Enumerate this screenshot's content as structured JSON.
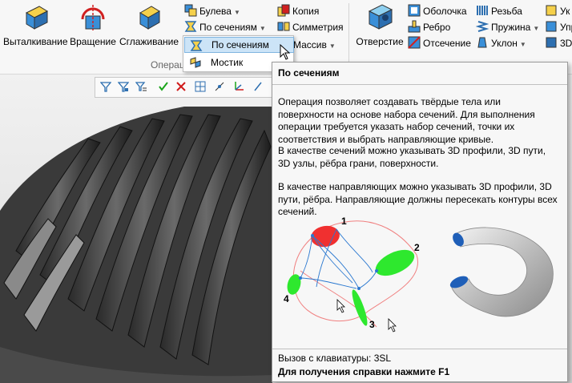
{
  "ribbon": {
    "extrude_label": "Выталкивание",
    "revolve_label": "Вращение",
    "smooth_label": "Сглаживание",
    "boolean_label": "Булева",
    "loft_label": "По сечениям",
    "copy_label": "Копия",
    "symmetry_label": "Симметрия",
    "array_label": "Массив",
    "hole_label": "Отверстие",
    "shell_label": "Оболочка",
    "rib_label": "Ребро",
    "cutoff_label": "Отсечение",
    "thread_label": "Резьба",
    "spring_label": "Пружина",
    "draft_label": "Уклон",
    "edge_partial_1": "Ук",
    "edge_partial_2": "Упр",
    "edge_partial_3": "3D",
    "group_label": "Операц"
  },
  "dropdown": {
    "items": [
      {
        "label": "По сечениям"
      },
      {
        "label": "Мостик"
      }
    ]
  },
  "tooltip": {
    "title": "По сечениям",
    "para1": "Операция позволяет создавать твёрдые тела или поверхности на основе набора сечений. Для выполнения операции требуется указать набор сечений, точки их соответствия и выбрать направляющие кривые.",
    "para2": "В качестве сечений можно указывать 3D профили, 3D пути, 3D узлы, рёбра грани, поверхности.",
    "para3": "В качестве направляющих можно указывать 3D профили, 3D пути, рёбра. Направляющие должны пересекать контуры всех сечений.",
    "markers": [
      "1",
      "2",
      "3",
      "4"
    ],
    "shortcut": "Вызов с клавиатуры: 3SL",
    "help": "Для получения справки нажмите F1"
  },
  "colors": {
    "section_red": "#f03030",
    "section_green": "#2ee82e",
    "guide_blue": "#2a78d0",
    "hud_check": "#1aa51a",
    "hud_cross": "#d01a1a"
  }
}
